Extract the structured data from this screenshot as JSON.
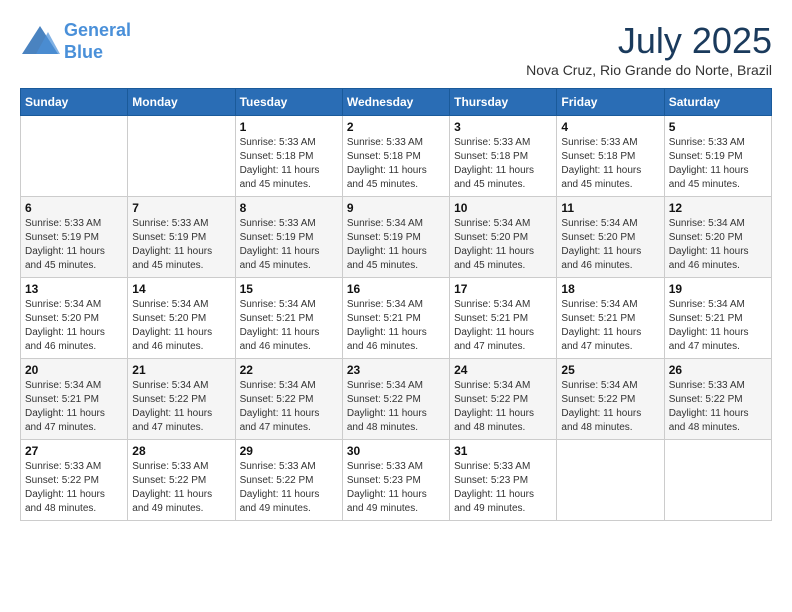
{
  "header": {
    "logo_line1": "General",
    "logo_line2": "Blue",
    "month_title": "July 2025",
    "subtitle": "Nova Cruz, Rio Grande do Norte, Brazil"
  },
  "days_of_week": [
    "Sunday",
    "Monday",
    "Tuesday",
    "Wednesday",
    "Thursday",
    "Friday",
    "Saturday"
  ],
  "weeks": [
    [
      {
        "day": "",
        "info": ""
      },
      {
        "day": "",
        "info": ""
      },
      {
        "day": "1",
        "info": "Sunrise: 5:33 AM\nSunset: 5:18 PM\nDaylight: 11 hours and 45 minutes."
      },
      {
        "day": "2",
        "info": "Sunrise: 5:33 AM\nSunset: 5:18 PM\nDaylight: 11 hours and 45 minutes."
      },
      {
        "day": "3",
        "info": "Sunrise: 5:33 AM\nSunset: 5:18 PM\nDaylight: 11 hours and 45 minutes."
      },
      {
        "day": "4",
        "info": "Sunrise: 5:33 AM\nSunset: 5:18 PM\nDaylight: 11 hours and 45 minutes."
      },
      {
        "day": "5",
        "info": "Sunrise: 5:33 AM\nSunset: 5:19 PM\nDaylight: 11 hours and 45 minutes."
      }
    ],
    [
      {
        "day": "6",
        "info": "Sunrise: 5:33 AM\nSunset: 5:19 PM\nDaylight: 11 hours and 45 minutes."
      },
      {
        "day": "7",
        "info": "Sunrise: 5:33 AM\nSunset: 5:19 PM\nDaylight: 11 hours and 45 minutes."
      },
      {
        "day": "8",
        "info": "Sunrise: 5:33 AM\nSunset: 5:19 PM\nDaylight: 11 hours and 45 minutes."
      },
      {
        "day": "9",
        "info": "Sunrise: 5:34 AM\nSunset: 5:19 PM\nDaylight: 11 hours and 45 minutes."
      },
      {
        "day": "10",
        "info": "Sunrise: 5:34 AM\nSunset: 5:20 PM\nDaylight: 11 hours and 45 minutes."
      },
      {
        "day": "11",
        "info": "Sunrise: 5:34 AM\nSunset: 5:20 PM\nDaylight: 11 hours and 46 minutes."
      },
      {
        "day": "12",
        "info": "Sunrise: 5:34 AM\nSunset: 5:20 PM\nDaylight: 11 hours and 46 minutes."
      }
    ],
    [
      {
        "day": "13",
        "info": "Sunrise: 5:34 AM\nSunset: 5:20 PM\nDaylight: 11 hours and 46 minutes."
      },
      {
        "day": "14",
        "info": "Sunrise: 5:34 AM\nSunset: 5:20 PM\nDaylight: 11 hours and 46 minutes."
      },
      {
        "day": "15",
        "info": "Sunrise: 5:34 AM\nSunset: 5:21 PM\nDaylight: 11 hours and 46 minutes."
      },
      {
        "day": "16",
        "info": "Sunrise: 5:34 AM\nSunset: 5:21 PM\nDaylight: 11 hours and 46 minutes."
      },
      {
        "day": "17",
        "info": "Sunrise: 5:34 AM\nSunset: 5:21 PM\nDaylight: 11 hours and 47 minutes."
      },
      {
        "day": "18",
        "info": "Sunrise: 5:34 AM\nSunset: 5:21 PM\nDaylight: 11 hours and 47 minutes."
      },
      {
        "day": "19",
        "info": "Sunrise: 5:34 AM\nSunset: 5:21 PM\nDaylight: 11 hours and 47 minutes."
      }
    ],
    [
      {
        "day": "20",
        "info": "Sunrise: 5:34 AM\nSunset: 5:21 PM\nDaylight: 11 hours and 47 minutes."
      },
      {
        "day": "21",
        "info": "Sunrise: 5:34 AM\nSunset: 5:22 PM\nDaylight: 11 hours and 47 minutes."
      },
      {
        "day": "22",
        "info": "Sunrise: 5:34 AM\nSunset: 5:22 PM\nDaylight: 11 hours and 47 minutes."
      },
      {
        "day": "23",
        "info": "Sunrise: 5:34 AM\nSunset: 5:22 PM\nDaylight: 11 hours and 48 minutes."
      },
      {
        "day": "24",
        "info": "Sunrise: 5:34 AM\nSunset: 5:22 PM\nDaylight: 11 hours and 48 minutes."
      },
      {
        "day": "25",
        "info": "Sunrise: 5:34 AM\nSunset: 5:22 PM\nDaylight: 11 hours and 48 minutes."
      },
      {
        "day": "26",
        "info": "Sunrise: 5:33 AM\nSunset: 5:22 PM\nDaylight: 11 hours and 48 minutes."
      }
    ],
    [
      {
        "day": "27",
        "info": "Sunrise: 5:33 AM\nSunset: 5:22 PM\nDaylight: 11 hours and 48 minutes."
      },
      {
        "day": "28",
        "info": "Sunrise: 5:33 AM\nSunset: 5:22 PM\nDaylight: 11 hours and 49 minutes."
      },
      {
        "day": "29",
        "info": "Sunrise: 5:33 AM\nSunset: 5:22 PM\nDaylight: 11 hours and 49 minutes."
      },
      {
        "day": "30",
        "info": "Sunrise: 5:33 AM\nSunset: 5:23 PM\nDaylight: 11 hours and 49 minutes."
      },
      {
        "day": "31",
        "info": "Sunrise: 5:33 AM\nSunset: 5:23 PM\nDaylight: 11 hours and 49 minutes."
      },
      {
        "day": "",
        "info": ""
      },
      {
        "day": "",
        "info": ""
      }
    ]
  ]
}
